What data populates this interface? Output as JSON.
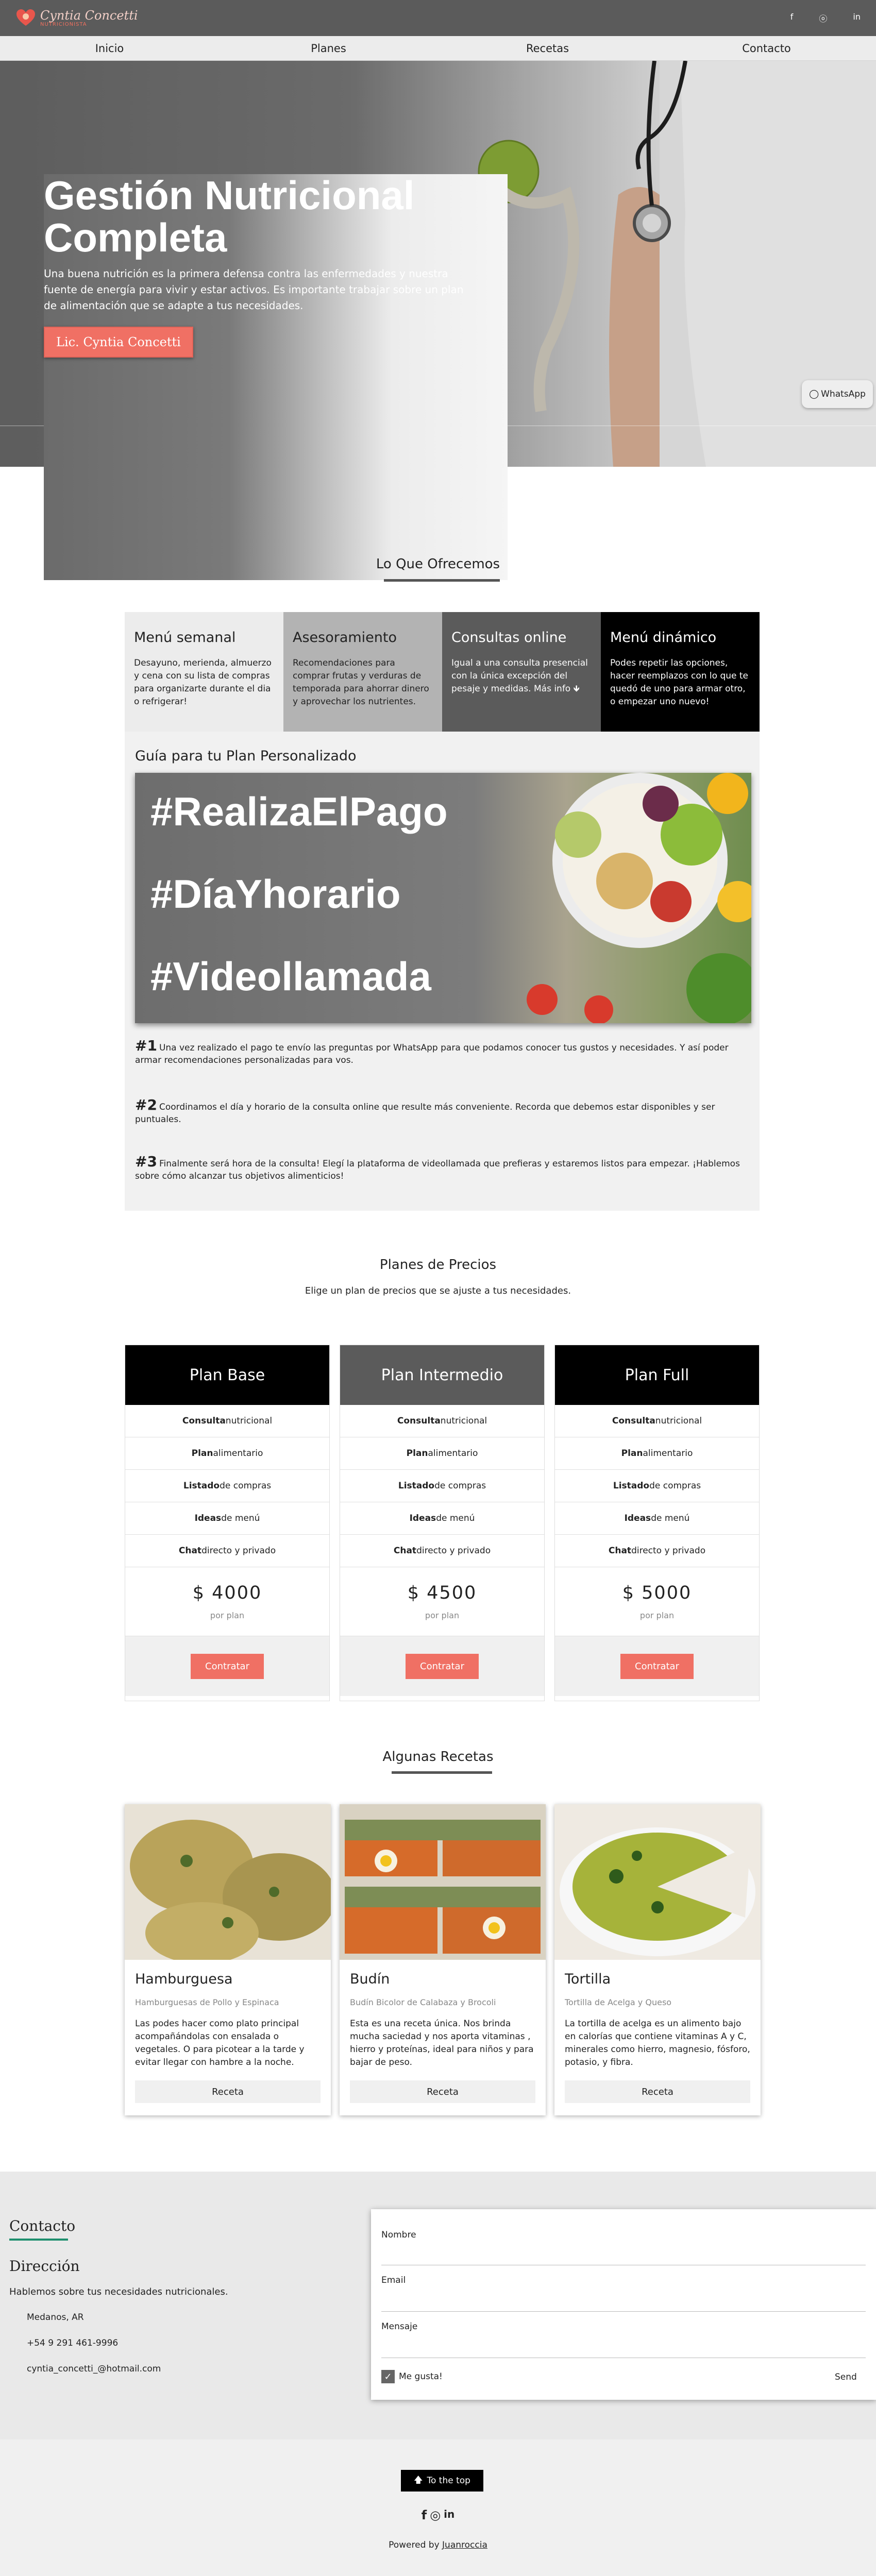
{
  "brand": {
    "name": "Cyntia Concetti",
    "subtitle": "NUTRICIONISTA",
    "accent": "#f07064"
  },
  "top_social": [
    "f",
    "ⓞ",
    "in"
  ],
  "nav": [
    "Inicio",
    "Planes",
    "Recetas",
    "Contacto"
  ],
  "hero": {
    "title": "Gestión Nutricional Completa",
    "text": "Una buena nutrición es la primera defensa contra las enfermedades y nuestra fuente de energía para vivir y estar activos. Es importante trabajar sobre un plan de alimentación que se adapte a tus necesidades.",
    "button": "Lic. Cyntia Concetti",
    "whatsapp": "WhatsApp"
  },
  "offers": {
    "title": "Lo Que Ofrecemos",
    "items": [
      {
        "title": "Menú semanal",
        "text": "Desayuno, merienda, almuerzo y cena con su lista de compras para organizarte durante el dia o refrigerar!",
        "bg": "#ececec",
        "color": "#222"
      },
      {
        "title": "Asesoramiento",
        "text": "Recomendaciones para comprar frutas y verduras de temporada para ahorrar dinero y aprovechar los nutrientes.",
        "bg": "#b3b3b3",
        "color": "#222"
      },
      {
        "title": "Consultas online",
        "text": "Igual a una consulta presencial con la única excepción del pesaje y medidas. Más info 🡻",
        "bg": "#5b5b5b",
        "color": "#fff"
      },
      {
        "title": "Menú dinámico",
        "text": "Podes repetir las opciones, hacer reemplazos con lo que te quedó de uno para armar otro, o empezar uno nuevo!",
        "bg": "#000000",
        "color": "#fff"
      }
    ]
  },
  "guide": {
    "title": "Guía para tu Plan Personalizado",
    "tags": [
      "#RealizaElPago",
      "#DíaYhorario",
      "#Videollamada"
    ],
    "steps": [
      {
        "num": "#1",
        "text": "Una vez realizado el pago te envío las preguntas por WhatsApp para que podamos conocer tus gustos y necesidades. Y así poder armar recomendaciones personalizadas para vos."
      },
      {
        "num": "#2",
        "text": "Coordinamos el día y horario de la consulta online que resulte más conveniente. Recorda que debemos estar disponibles y ser puntuales."
      },
      {
        "num": "#3",
        "text": "Finalmente será hora de la consulta! Elegí la plataforma de videollamada que prefieras y estaremos listos para empezar. ¡Hablemos sobre cómo alcanzar tus objetivos alimenticios!"
      }
    ]
  },
  "plans": {
    "title": "Planes de Precios",
    "subtitle": "Elige un plan de precios que se ajuste a tus necesidades.",
    "features": [
      {
        "bold": "Consulta",
        "rest": " nutricional"
      },
      {
        "bold": "Plan",
        "rest": " alimentario"
      },
      {
        "bold": "Listado",
        "rest": " de compras"
      },
      {
        "bold": "Ideas",
        "rest": " de menú"
      },
      {
        "bold": "Chat",
        "rest": " directo y privado"
      }
    ],
    "items": [
      {
        "name": "Plan Base",
        "price": "$ 4000",
        "per": "por plan",
        "button": "Contratar",
        "head_bg": "#000000"
      },
      {
        "name": "Plan Intermedio",
        "price": "$ 4500",
        "per": "por plan",
        "button": "Contratar",
        "head_bg": "#5b5b5b"
      },
      {
        "name": "Plan Full",
        "price": "$ 5000",
        "per": "por plan",
        "button": "Contratar",
        "head_bg": "#000000"
      }
    ]
  },
  "recipes": {
    "title": "Algunas Recetas",
    "items": [
      {
        "name": "Hamburguesa",
        "sub": "Hamburguesas de Pollo y Espinaca",
        "desc": "Las podes hacer como plato principal acompañándolas con ensalada o vegetales. O para picotear a la tarde y evitar llegar con hambre a la noche.",
        "button": "Receta"
      },
      {
        "name": "Budín",
        "sub": "Budín Bicolor de Calabaza y Brocoli",
        "desc": "Esta es una receta única. Nos brinda mucha saciedad y nos aporta vitaminas , hierro y proteínas, ideal para niños y para bajar de peso.",
        "button": "Receta"
      },
      {
        "name": "Tortilla",
        "sub": "Tortilla de Acelga y Queso",
        "desc": "La tortilla de acelga es un alimento bajo en calorías que contiene vitaminas A y C, minerales como hierro, magnesio, fósforo, potasio, y fibra.",
        "button": "Receta"
      }
    ]
  },
  "contact": {
    "title": "Contacto",
    "dir_title": "Dirección",
    "desc": "Hablemos sobre tus necesidades nutricionales.",
    "items": [
      "Medanos, AR",
      "+54 9 291 461-9996",
      "cyntia_concetti_@hotmail.com"
    ],
    "form": {
      "name": "Nombre",
      "email": "Email",
      "message": "Mensaje",
      "like": "Me gusta!",
      "send": "Send"
    }
  },
  "footer": {
    "top_button": "To the top",
    "powered": "Powered by",
    "author": "Juanroccia"
  }
}
